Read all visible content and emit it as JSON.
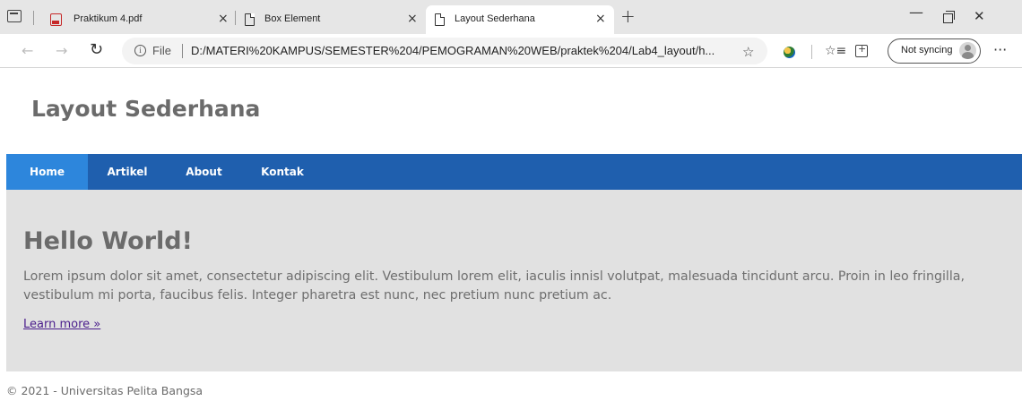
{
  "browser": {
    "tabs": [
      {
        "title": "Praktikum 4.pdf",
        "icon": "pdf-icon",
        "active": false
      },
      {
        "title": "Box Element",
        "icon": "document-icon",
        "active": false
      },
      {
        "title": "Layout Sederhana",
        "icon": "document-icon",
        "active": true
      }
    ],
    "close_glyph": "×",
    "new_tab_glyph": "+",
    "address": {
      "scheme_label": "File",
      "url": "D:/MATERI%20KAMPUS/SEMESTER%204/PEMOGRAMAN%20WEB/praktek%204/Lab4_layout/h..."
    },
    "sync_label": "Not syncing",
    "more_glyph": "···"
  },
  "page": {
    "site_title": "Layout Sederhana",
    "nav": [
      {
        "label": "Home",
        "active": true
      },
      {
        "label": "Artikel",
        "active": false
      },
      {
        "label": "About",
        "active": false
      },
      {
        "label": "Kontak",
        "active": false
      }
    ],
    "hero": {
      "title": "Hello World!",
      "text": "Lorem ipsum dolor sit amet, consectetur adipiscing elit. Vestibulum lorem elit, iaculis innisl volutpat, malesuada tincidunt arcu. Proin in leo fringilla, vestibulum mi porta, faucibus felis. Integer pharetra est nunc, nec pretium nunc pretium ac.",
      "link": "Learn more »"
    },
    "footer": "© 2021 - Universitas Pelita Bangsa"
  },
  "colors": {
    "nav_bg": "#1f5fae",
    "nav_active": "#2d86dc",
    "hero_bg": "#e1e1e1",
    "heading_text": "#6b6b6b",
    "link": "#4a1d8c"
  }
}
